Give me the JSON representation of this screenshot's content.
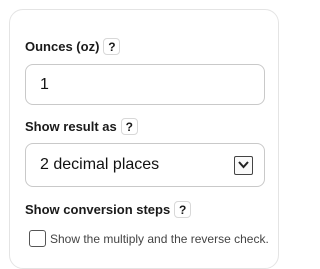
{
  "ounces": {
    "label": "Ounces (oz)",
    "help": "?",
    "value": "1"
  },
  "result": {
    "label": "Show result as",
    "help": "?",
    "selected": "2 decimal places"
  },
  "steps": {
    "label": "Show conversion steps",
    "help": "?",
    "checkbox_label": "Show the multiply and the reverse check.",
    "checked": false
  }
}
